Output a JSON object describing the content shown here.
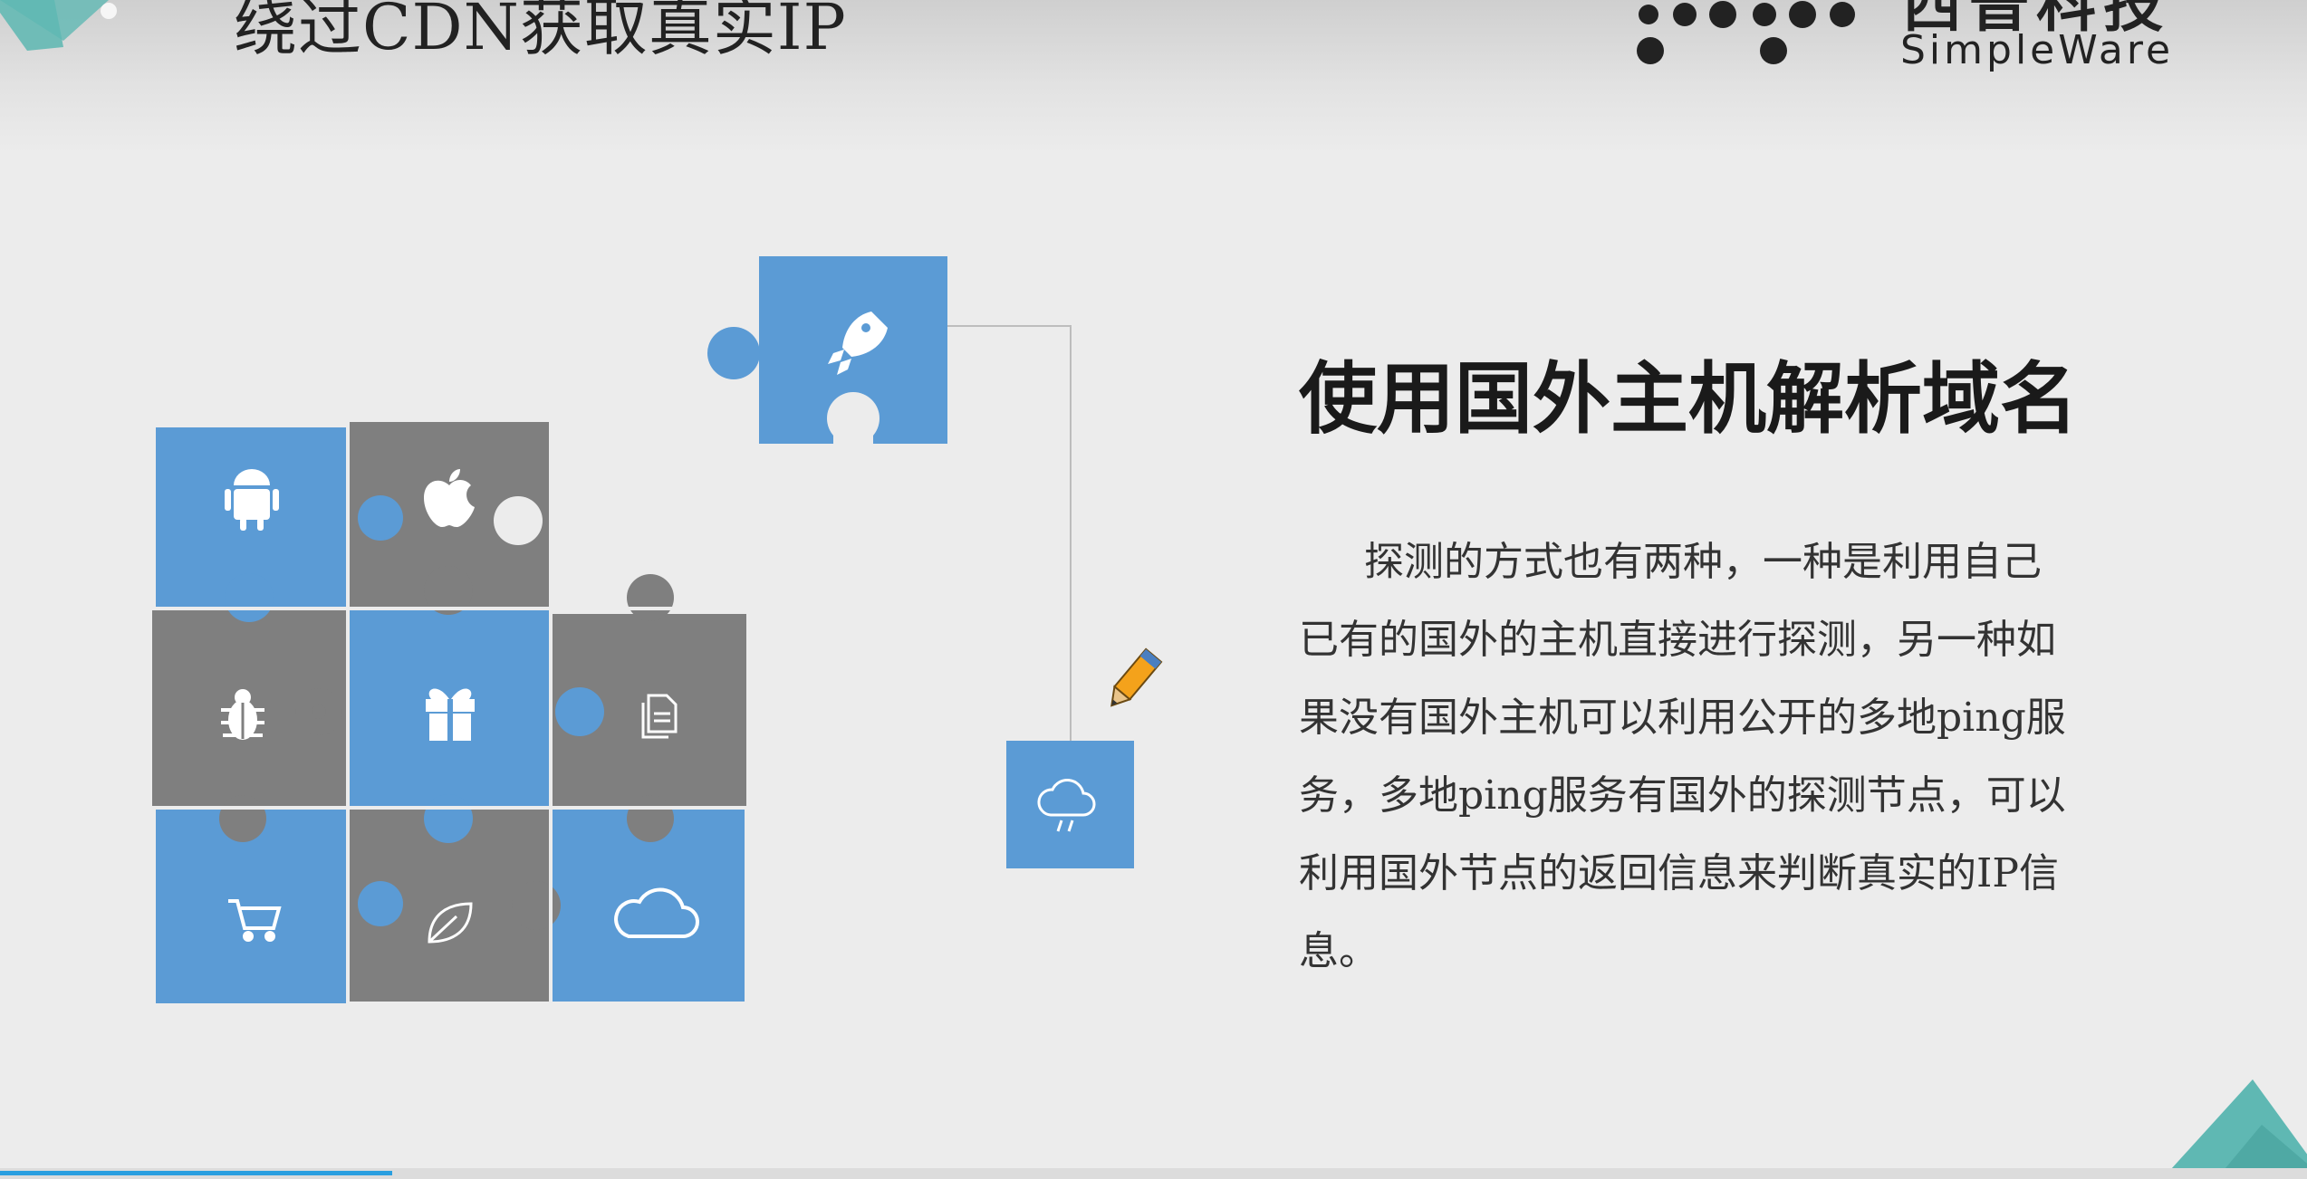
{
  "slide": {
    "title": "绕过CDN获取真实IP",
    "logo": {
      "cn": "西普科技",
      "en": "SimpleWare"
    },
    "section_heading": "使用国外主机解析域名",
    "body_text": "探测的方式也有两种，一种是利用自己已有的国外的主机直接进行探测，另一种如果没有国外主机可以利用公开的多地ping服务，多地ping服务有国外的探测节点，可以利用国外节点的返回信息来判断真实的IP信息。"
  },
  "puzzle": {
    "pieces": [
      {
        "icon": "android-icon",
        "color": "blue"
      },
      {
        "icon": "apple-icon",
        "color": "gray"
      },
      {
        "icon": "bug-icon",
        "color": "gray"
      },
      {
        "icon": "gift-icon",
        "color": "blue"
      },
      {
        "icon": "document-icon",
        "color": "gray"
      },
      {
        "icon": "cart-icon",
        "color": "blue"
      },
      {
        "icon": "leaf-icon",
        "color": "gray"
      },
      {
        "icon": "cloud-icon",
        "color": "blue"
      }
    ],
    "detached_piece_icon": "rocket-icon",
    "small_tile_icon": "cloud-rain-icon",
    "pencil_icon": "pencil-icon"
  },
  "colors": {
    "blue": "#5b9bd5",
    "gray": "#7f7f7f",
    "teal": "#5fb8b3",
    "progress": "#2a9fe0"
  },
  "progress": 0.17
}
